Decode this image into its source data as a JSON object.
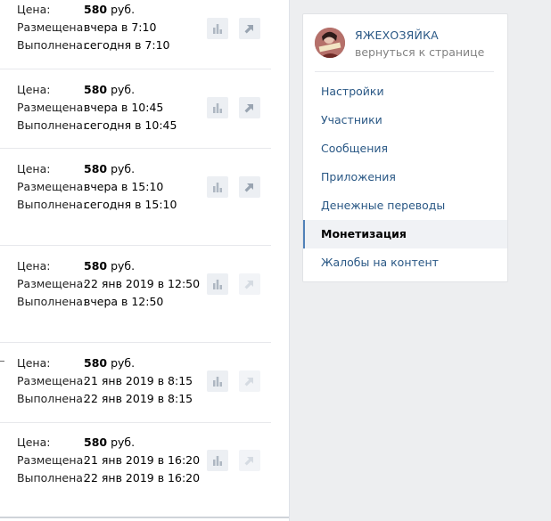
{
  "orders": [
    {
      "price_label": "Цена:",
      "price": "580",
      "price_unit": "руб.",
      "placed_label": "Размещена:",
      "placed": "вчера в 7:10",
      "done_label": "Выполнена:",
      "done": "сегодня в 7:10",
      "share_enabled": true
    },
    {
      "price_label": "Цена:",
      "price": "580",
      "price_unit": "руб.",
      "placed_label": "Размещена:",
      "placed": "вчера в 10:45",
      "done_label": "Выполнена:",
      "done": "сегодня в 10:45",
      "share_enabled": true
    },
    {
      "price_label": "Цена:",
      "price": "580",
      "price_unit": "руб.",
      "placed_label": "Размещена:",
      "placed": "вчера в 15:10",
      "done_label": "Выполнена:",
      "done": "сегодня в 15:10",
      "share_enabled": true
    },
    {
      "price_label": "Цена:",
      "price": "580",
      "price_unit": "руб.",
      "placed_label": "Размещена:",
      "placed": "22 янв 2019 в 12:50",
      "done_label": "Выполнена:",
      "done": "вчера в 12:50",
      "share_enabled": false
    },
    {
      "price_label": "Цена:",
      "price": "580",
      "price_unit": "руб.",
      "placed_label": "Размещена:",
      "placed": "21 янв 2019 в 8:15",
      "done_label": "Выполнена:",
      "done": "22 янв 2019 в 8:15",
      "share_enabled": false
    },
    {
      "price_label": "Цена:",
      "price": "580",
      "price_unit": "руб.",
      "placed_label": "Размещена:",
      "placed": "21 янв 2019 в 16:20",
      "done_label": "Выполнена:",
      "done": "22 янв 2019 в 16:20",
      "share_enabled": false
    }
  ],
  "group": {
    "name": "ЯЖЕХОЗЯЙКА",
    "back_link": "вернуться к странице"
  },
  "menu": [
    {
      "label": "Настройки",
      "active": false
    },
    {
      "label": "Участники",
      "active": false
    },
    {
      "label": "Сообщения",
      "active": false
    },
    {
      "label": "Приложения",
      "active": false
    },
    {
      "label": "Денежные переводы",
      "active": false
    },
    {
      "label": "Монетизация",
      "active": true
    },
    {
      "label": "Жалобы на контент",
      "active": false
    }
  ],
  "colors": {
    "link": "#2a5885",
    "accent": "#5181b8",
    "page_bg": "#edeef0"
  }
}
